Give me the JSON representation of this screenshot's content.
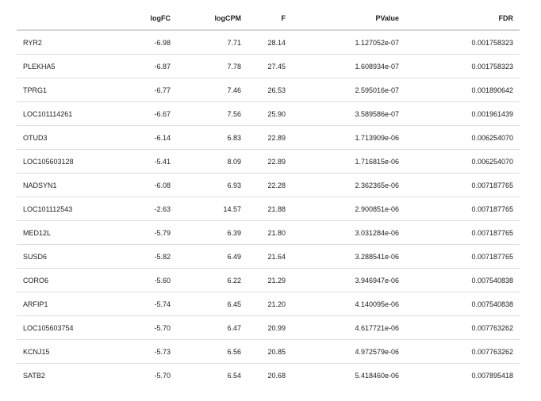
{
  "table": {
    "columns": [
      "",
      "logFC",
      "logCPM",
      "F",
      "PValue",
      "FDR"
    ],
    "rows": [
      [
        "RYR2",
        "-6.98",
        "7.71",
        "28.14",
        "1.127052e-07",
        "0.001758323"
      ],
      [
        "PLEKHA5",
        "-6.87",
        "7.78",
        "27.45",
        "1.608934e-07",
        "0.001758323"
      ],
      [
        "TPRG1",
        "-6.77",
        "7.46",
        "26.53",
        "2.595016e-07",
        "0.001890642"
      ],
      [
        "LOC101114261",
        "-6.67",
        "7.56",
        "25.90",
        "3.589586e-07",
        "0.001961439"
      ],
      [
        "OTUD3",
        "-6.14",
        "6.83",
        "22.89",
        "1.713909e-06",
        "0.006254070"
      ],
      [
        "LOC105603128",
        "-5.41",
        "8.09",
        "22.89",
        "1.716815e-06",
        "0.006254070"
      ],
      [
        "NADSYN1",
        "-6.08",
        "6.93",
        "22.28",
        "2.362365e-06",
        "0.007187765"
      ],
      [
        "LOC101112543",
        "-2.63",
        "14.57",
        "21.88",
        "2.900851e-06",
        "0.007187765"
      ],
      [
        "MED12L",
        "-5.79",
        "6.39",
        "21.80",
        "3.031284e-06",
        "0.007187765"
      ],
      [
        "SUSD6",
        "-5.82",
        "6.49",
        "21.64",
        "3.288541e-06",
        "0.007187765"
      ],
      [
        "CORO6",
        "-5.60",
        "6.22",
        "21.29",
        "3.946947e-06",
        "0.007540838"
      ],
      [
        "ARFIP1",
        "-5.74",
        "6.45",
        "21.20",
        "4.140095e-06",
        "0.007540838"
      ],
      [
        "LOC105603754",
        "-5.70",
        "6.47",
        "20.99",
        "4.617721e-06",
        "0.007763262"
      ],
      [
        "KCNJ15",
        "-5.73",
        "6.56",
        "20.85",
        "4.972579e-06",
        "0.007763262"
      ],
      [
        "SATB2",
        "-5.70",
        "6.54",
        "20.68",
        "5.418460e-06",
        "0.007895418"
      ]
    ]
  }
}
